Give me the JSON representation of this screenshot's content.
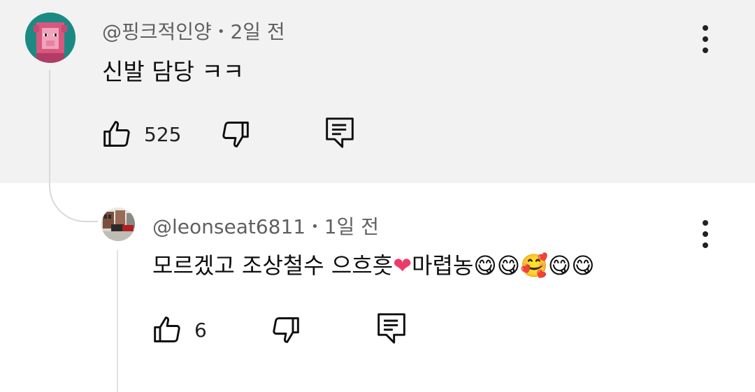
{
  "comments": [
    {
      "author": "@핑크적인양",
      "separator": "•",
      "time": "2일 전",
      "text": "신발 담당 ㅋㅋ",
      "likes": "525",
      "avatar_icon": "pink-sheep-avatar-icon",
      "colors": {
        "background": "#f2f2f2",
        "avatar_bg": "#1c8a83",
        "avatar_face": "#cf4f7a"
      }
    },
    {
      "author": "@leonseat6811",
      "separator": "•",
      "time": "1일 전",
      "text": "모르겠고 조상철수 으흐흣",
      "emoji_heart": "❤",
      "text_tail": "마렵농",
      "emojis": [
        "😋",
        "😋",
        "🥰",
        "😋",
        "😋"
      ],
      "likes": "6",
      "avatar_icon": "street-photo-avatar-icon"
    }
  ],
  "icons": {
    "like": "thumbs-up-icon",
    "dislike": "thumbs-down-icon",
    "reply": "reply-comment-icon",
    "more": "more-vertical-icon"
  }
}
